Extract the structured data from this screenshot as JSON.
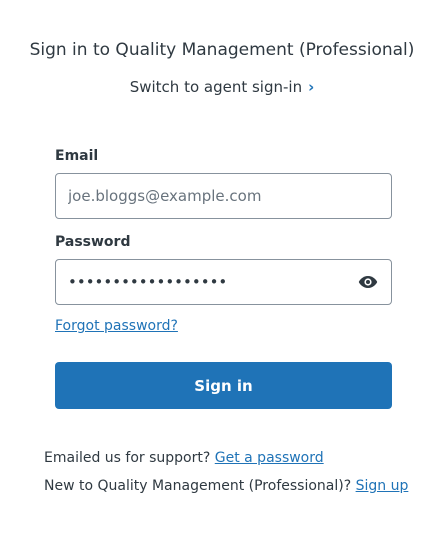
{
  "header": {
    "title": "Sign in to Quality Management (Professional)",
    "switch_link": "Switch to agent sign-in"
  },
  "form": {
    "email_label": "Email",
    "email_placeholder": "joe.bloggs@example.com",
    "password_label": "Password",
    "password_masked": "••••••••••••••••••",
    "forgot_link": "Forgot password?",
    "submit_label": "Sign in"
  },
  "footer": {
    "support_text": "Emailed us for support?",
    "support_link": "Get a password",
    "signup_text": "New to Quality Management (Professional)?",
    "signup_link": "Sign up"
  },
  "icons": {
    "switch_chevron": "chevron-right-icon",
    "password_toggle": "eye-icon"
  },
  "colors": {
    "accent": "#1f73b7",
    "text": "#2f3941",
    "border": "#87929d"
  }
}
